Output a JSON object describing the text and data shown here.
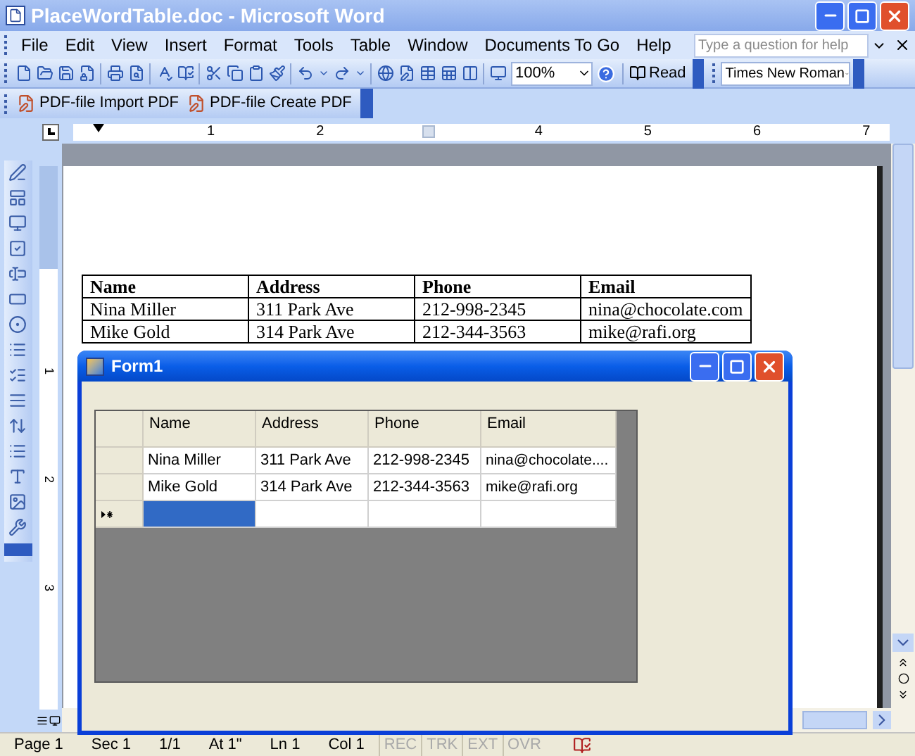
{
  "window": {
    "title": "PlaceWordTable.doc - Microsoft Word"
  },
  "menu": [
    "File",
    "Edit",
    "View",
    "Insert",
    "Format",
    "Tools",
    "Table",
    "Window",
    "Documents To Go",
    "Help"
  ],
  "help_field": {
    "placeholder": "Type a question for help"
  },
  "toolbar": {
    "zoom": "100%",
    "read": "Read",
    "font": "Times New Roman"
  },
  "pdf_toolbar": [
    "PDF-file Import PDF",
    "PDF-file Create PDF"
  ],
  "ruler": [
    {
      "kind": "number",
      "text": "1"
    },
    {
      "kind": "number",
      "text": "2"
    },
    {
      "kind": "marker"
    },
    {
      "kind": "number",
      "text": "4"
    },
    {
      "kind": "number",
      "text": "5"
    },
    {
      "kind": "number",
      "text": "6"
    },
    {
      "kind": "number",
      "text": "7"
    }
  ],
  "vertical_ruler": [
    "1",
    "2",
    "3"
  ],
  "document_table": {
    "columns": [
      "Name",
      "Address",
      "Phone",
      "Email"
    ],
    "rows": [
      [
        "Nina Miller",
        "311 Park Ave",
        "212-998-2345",
        "nina@chocolate.com"
      ],
      [
        "Mike Gold",
        "314 Park Ave",
        "212-344-3563",
        "mike@rafi.org"
      ]
    ]
  },
  "form": {
    "title": "Form1",
    "grid": {
      "columns": [
        "Name",
        "Address",
        "Phone",
        "Email"
      ],
      "rows": [
        [
          "Nina Miller",
          "311 Park Ave",
          "212-998-2345",
          "nina@chocolate...."
        ],
        [
          "Mike Gold",
          "314 Park Ave",
          "212-344-3563",
          "mike@rafi.org"
        ]
      ],
      "new_row": [
        {
          "selected": true
        },
        {
          "selected": false
        },
        {
          "selected": false
        },
        {
          "selected": false
        }
      ]
    }
  },
  "status_bar": [
    {
      "text": "Page 1",
      "disabled": false
    },
    {
      "text": "Sec 1",
      "disabled": false
    },
    {
      "text": "1/1",
      "disabled": false
    },
    {
      "text": "At 1\"",
      "disabled": false
    },
    {
      "text": "Ln 1",
      "disabled": false
    },
    {
      "text": "Col 1",
      "disabled": false
    },
    {
      "text": "REC",
      "disabled": true
    },
    {
      "text": "TRK",
      "disabled": true
    },
    {
      "text": "EXT",
      "disabled": true
    },
    {
      "text": "OVR",
      "disabled": true
    }
  ]
}
